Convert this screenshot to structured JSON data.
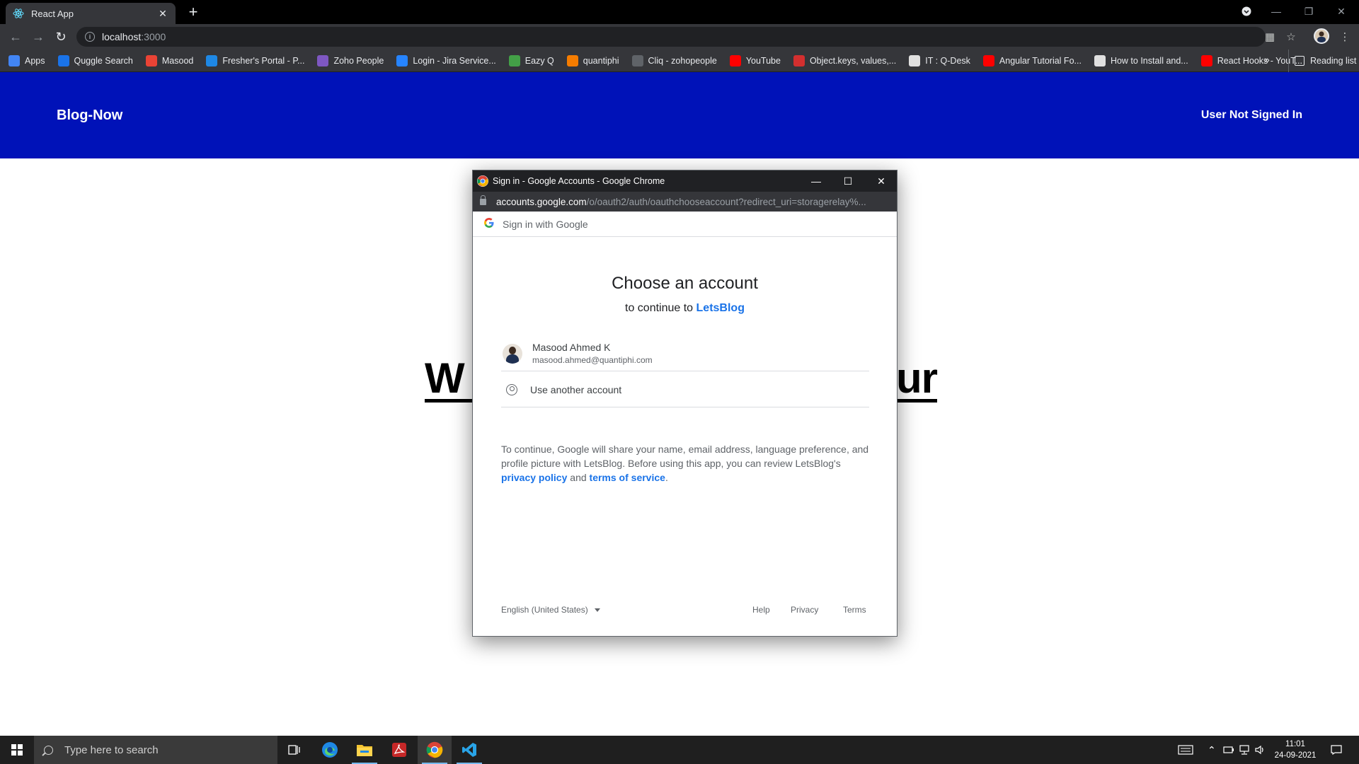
{
  "browser": {
    "tab_title": "React App",
    "address_host": "localhost",
    "address_port": ":3000",
    "bookmarks": [
      {
        "label": "Apps",
        "icon": "apps-grid-icon",
        "color": "#4285f4"
      },
      {
        "label": "Quggle Search",
        "icon": "search-q-icon",
        "color": "#1a73e8"
      },
      {
        "label": "Masood",
        "icon": "gmail-icon",
        "color": "#ea4335"
      },
      {
        "label": "Fresher's Portal - P...",
        "icon": "portal-icon",
        "color": "#1e88e5"
      },
      {
        "label": "Zoho People",
        "icon": "zoho-people-icon",
        "color": "#7e57c2"
      },
      {
        "label": "Login - Jira Service...",
        "icon": "jira-icon",
        "color": "#2684ff"
      },
      {
        "label": "Eazy Q",
        "icon": "eazyq-icon",
        "color": "#43a047"
      },
      {
        "label": "quantiphi",
        "icon": "quantiphi-icon",
        "color": "#f57c00"
      },
      {
        "label": "Cliq - zohopeople",
        "icon": "cliq-icon",
        "color": "#5f6368"
      },
      {
        "label": "YouTube",
        "icon": "youtube-icon",
        "color": "#ff0000"
      },
      {
        "label": "Object.keys, values,...",
        "icon": "x-icon",
        "color": "#d32f2f"
      },
      {
        "label": "IT : Q-Desk",
        "icon": "qdesk-icon",
        "color": "#e0e0e0"
      },
      {
        "label": "Angular Tutorial Fo...",
        "icon": "youtube-icon",
        "color": "#ff0000"
      },
      {
        "label": "How to Install and...",
        "icon": "t-icon",
        "color": "#e0e0e0"
      },
      {
        "label": "React Hooks - YouT...",
        "icon": "youtube-icon",
        "color": "#ff0000"
      }
    ],
    "bookmarks_more": "»",
    "reading_list": "Reading list"
  },
  "app": {
    "brand": "Blog-Now",
    "user_status": "User Not Signed In",
    "hero_left": "W",
    "hero_right": "ur",
    "header_color": "#0012b8"
  },
  "popup": {
    "window_title": "Sign in - Google Accounts - Google Chrome",
    "url_host": "accounts.google.com",
    "url_path": "/o/oauth2/auth/oauthchooseaccount?redirect_uri=storagerelay%...",
    "sign_in_with": "Sign in with Google",
    "heading": "Choose an account",
    "continue_prefix": "to continue to",
    "app_name": "LetsBlog",
    "account": {
      "name": "Masood Ahmed K",
      "email": "masood.ahmed@quantiphi.com"
    },
    "use_another": "Use another account",
    "consent_text": "To continue, Google will share your name, email address, language preference, and profile picture with LetsBlog. Before using this app, you can review LetsBlog's",
    "privacy_policy": "privacy policy",
    "and_text": "and",
    "terms_of_service": "terms of service",
    "period": ".",
    "language": "English (United States)",
    "footer_help": "Help",
    "footer_privacy": "Privacy",
    "footer_terms": "Terms"
  },
  "taskbar": {
    "search_placeholder": "Type here to search",
    "time": "11:01",
    "date": "24-09-2021"
  }
}
